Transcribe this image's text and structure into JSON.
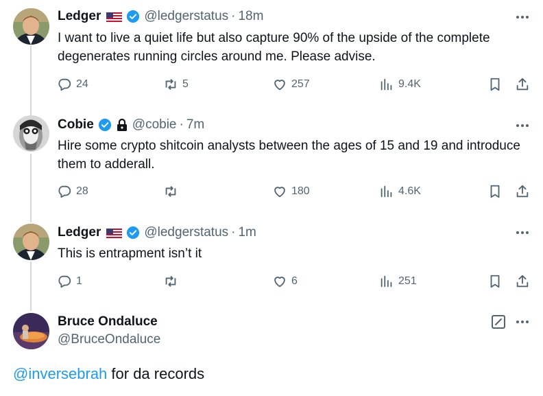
{
  "thread": [
    {
      "name": "Ledger",
      "handle": "@ledgerstatus",
      "separator": "·",
      "time": "18m",
      "text": "I want to live a quiet life but also capture 90% of the upside of the complete degenerates running circles around me. Please advise.",
      "replies": "24",
      "retweets": "5",
      "likes": "257",
      "views": "9.4K"
    },
    {
      "name": "Cobie",
      "handle": "@cobie",
      "separator": "·",
      "time": "7m",
      "text": "Hire some crypto shitcoin analysts between the ages of 15 and 19 and introduce them to adderall.",
      "replies": "28",
      "retweets": "",
      "likes": "180",
      "views": "4.6K"
    },
    {
      "name": "Ledger",
      "handle": "@ledgerstatus",
      "separator": "·",
      "time": "1m",
      "text": "This is entrapment isn’t it",
      "replies": "1",
      "retweets": "",
      "likes": "6",
      "views": "251"
    }
  ],
  "composer": {
    "name": "Bruce Ondaluce",
    "handle": "@BruceOndaluce",
    "mention": "@inversebrah",
    "body": " for da records"
  },
  "colors": {
    "accent": "#1d9bf0",
    "muted": "#536471",
    "thread_line": "#cfd9de"
  },
  "icons": [
    "flag-us-icon",
    "verified-badge-icon",
    "lock-icon",
    "more-icon",
    "reply-icon",
    "retweet-icon",
    "like-icon",
    "views-icon",
    "bookmark-icon",
    "share-icon",
    "edit-icon"
  ]
}
